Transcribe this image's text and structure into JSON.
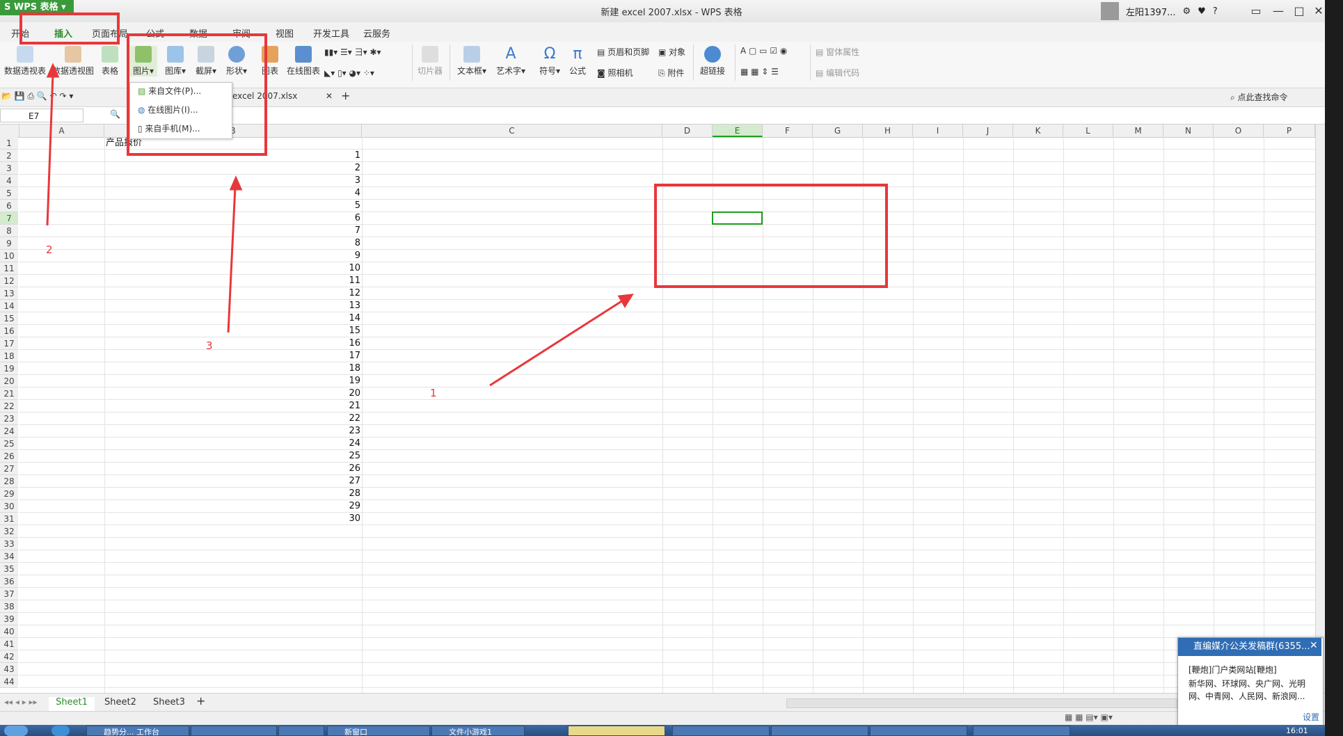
{
  "window": {
    "app_name": "WPS 表格",
    "title": "新建 excel 2007.xlsx - WPS 表格",
    "user": "左阳1397...",
    "help": "?"
  },
  "menu_tabs": [
    "开始",
    "插入",
    "页面布局",
    "公式",
    "数据",
    "审阅",
    "视图",
    "开发工具",
    "云服务"
  ],
  "ribbon": {
    "pivot_table": "数据透视表",
    "pivot_chart": "数据透视图",
    "table": "表格",
    "picture": "图片",
    "gallery": "图库",
    "screenshot": "截屏",
    "shapes": "形状",
    "chart": "图表",
    "online_chart": "在线图表",
    "slicer": "切片器",
    "textbox": "文本框",
    "wordart": "艺术字",
    "symbol": "符号",
    "formula": "公式",
    "header_footer": "页眉和页脚",
    "object": "对象",
    "camera": "照相机",
    "attachment": "附件",
    "hyperlink": "超链接",
    "control_props": "窗体属性",
    "edit_code": "编辑代码"
  },
  "picture_menu": [
    "来自文件(P)...",
    "在线图片(I)...",
    "来自手机(M)..."
  ],
  "doc_tab": "excel 2007.xlsx",
  "quick_find": "点此查找命令",
  "name_box": "E7",
  "columns": [
    "A",
    "B",
    "C",
    "D",
    "E",
    "F",
    "G",
    "H",
    "I",
    "J",
    "K",
    "L",
    "M",
    "N",
    "O",
    "P"
  ],
  "sheet": {
    "header_cell": "产品报价",
    "values": [
      "1",
      "2",
      "3",
      "4",
      "5",
      "6",
      "7",
      "8",
      "9",
      "10",
      "11",
      "12",
      "13",
      "14",
      "15",
      "16",
      "17",
      "18",
      "19",
      "20",
      "21",
      "22",
      "23",
      "24",
      "25",
      "26",
      "27",
      "28",
      "29",
      "30"
    ]
  },
  "row_numbers": [
    "1",
    "2",
    "3",
    "4",
    "5",
    "6",
    "7",
    "8",
    "9",
    "10",
    "11",
    "12",
    "13",
    "14",
    "15",
    "16",
    "17",
    "18",
    "19",
    "20",
    "21",
    "22",
    "23",
    "24",
    "25",
    "26",
    "27",
    "28",
    "29",
    "30",
    "31",
    "32",
    "33",
    "34",
    "35",
    "36",
    "37",
    "38",
    "39",
    "40",
    "41",
    "42",
    "43",
    "44"
  ],
  "annotations": [
    "1",
    "2",
    "3"
  ],
  "sheet_tabs": [
    "Sheet1",
    "Sheet2",
    "Sheet3"
  ],
  "notification": {
    "title": "直编媒介公关发稿群(6355...",
    "line1": "[鞭炮]门户类网站[鞭炮]",
    "line2": "新华网、环球网、央广网、光明",
    "line3": "网、中青网、人民网、新浪网...",
    "settings": "设置"
  },
  "taskbar": {
    "clock": "16:01",
    "items": [
      "趋势分... 工作台",
      "",
      "",
      "新窗口",
      "文件小游戏1",
      "",
      "",
      "",
      "",
      ""
    ]
  },
  "colors": {
    "accent_green": "#3a9a3a",
    "annotation_red": "#e8373a",
    "selection_green": "#1e9e1e"
  }
}
